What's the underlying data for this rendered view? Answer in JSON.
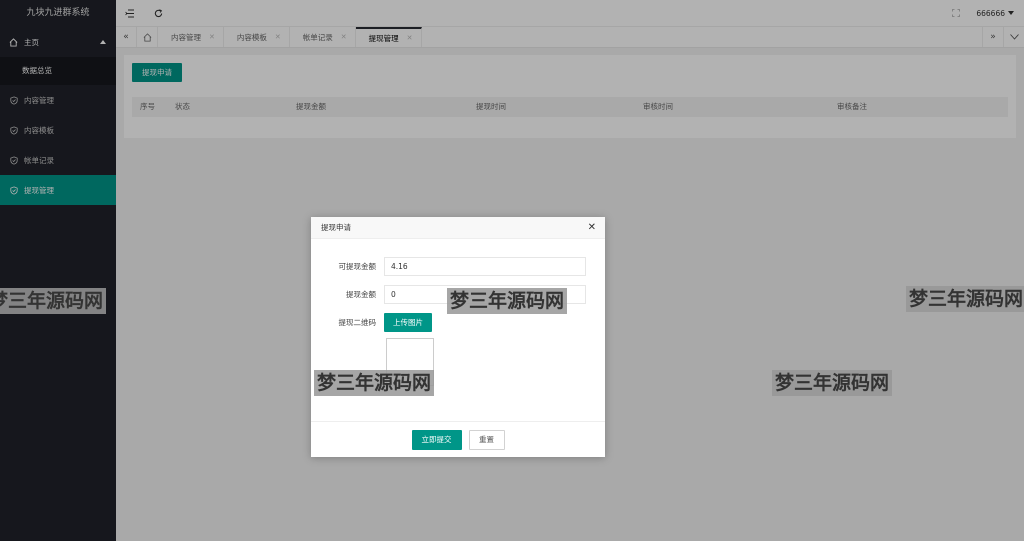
{
  "app": {
    "title": "九块九进群系统"
  },
  "sidebar": {
    "home": {
      "label": "主页"
    },
    "sub_items": [
      {
        "label": "数据总览"
      }
    ],
    "items": [
      {
        "label": "内容管理"
      },
      {
        "label": "内容模板"
      },
      {
        "label": "帐单记录"
      },
      {
        "label": "提现管理",
        "active": true
      }
    ]
  },
  "header": {
    "user": "666666"
  },
  "tabs": [
    {
      "label": "内容管理"
    },
    {
      "label": "内容模板"
    },
    {
      "label": "帐单记录"
    },
    {
      "label": "提现管理",
      "active": true
    }
  ],
  "main": {
    "apply_button": "提现申请",
    "table_headers": [
      "序号",
      "状态",
      "提现金额",
      "提现时间",
      "审核时间",
      "审核备注"
    ]
  },
  "modal": {
    "title": "提现申请",
    "fields": {
      "available_label": "可提现金额",
      "available_value": "4.16",
      "amount_label": "提现金额",
      "amount_value": "0",
      "qrcode_label": "提现二维码",
      "upload_label": "上传图片"
    },
    "submit_label": "立即提交",
    "reset_label": "重置"
  },
  "watermark": "梦三年源码网",
  "colors": {
    "accent": "#009688",
    "sidebar_bg": "#20222a"
  }
}
